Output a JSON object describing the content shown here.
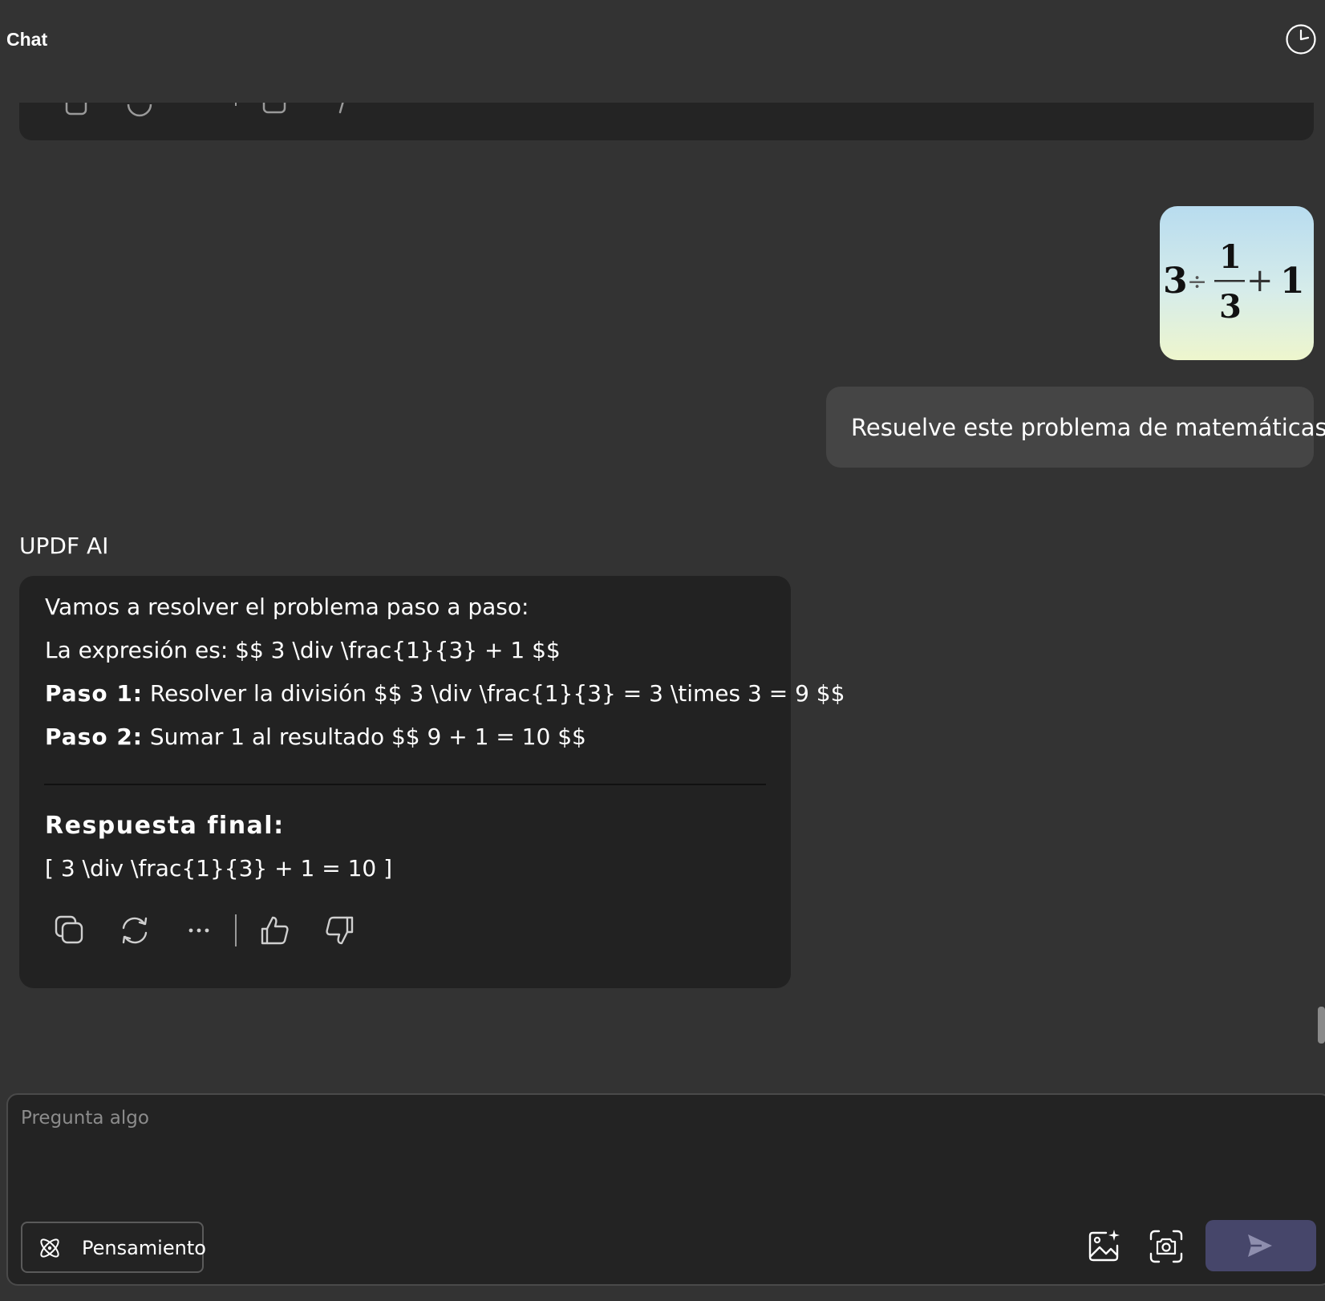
{
  "header": {
    "title": "Chat",
    "history_icon": "clock-icon"
  },
  "conversation": {
    "user_image": {
      "numerator": "1",
      "denominator": "3",
      "left_operand": "3",
      "divide_symbol": "÷",
      "plus_symbol": "+",
      "right_operand": "1"
    },
    "user_message": "Resuelve este problema de matemáticas.",
    "ai_label": "UPDF AI",
    "ai_response": {
      "intro": "Vamos a resolver el problema paso a paso:",
      "expression": "La expresión es: $$ 3 \\div \\frac{1}{3} + 1 $$",
      "step1_label": "Paso 1:",
      "step1_text": " Resolver la división $$ 3 \\div \\frac{1}{3} = 3 \\times 3 = 9 $$",
      "step2_label": "Paso 2:",
      "step2_text": " Sumar 1 al resultado $$ 9 + 1 = 10 $$",
      "final_title": "Respuesta final:",
      "final_answer": "[ 3 \\div \\frac{1}{3} + 1 = 10 ]"
    },
    "actions": [
      "copy-icon",
      "regenerate-icon",
      "more-icon",
      "thumbs-up-icon",
      "thumbs-down-icon"
    ]
  },
  "composer": {
    "placeholder": "Pregunta algo",
    "think_label": "Pensamiento",
    "tools": [
      "image-ai-icon",
      "screenshot-icon",
      "send-icon"
    ]
  },
  "colors": {
    "background": "#333333",
    "card": "#222222",
    "user_bubble": "#454545",
    "send_button": "#46466a"
  }
}
